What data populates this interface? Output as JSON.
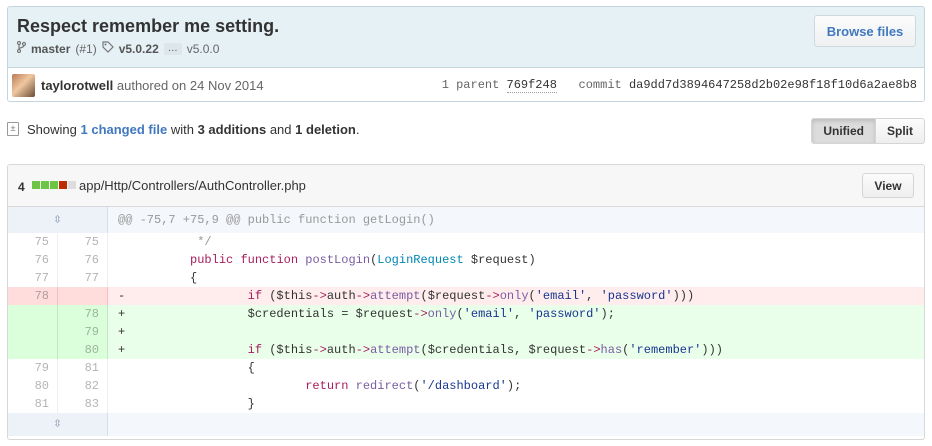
{
  "commit": {
    "title": "Respect remember me setting.",
    "branch": "master",
    "pr_ref": "(#1)",
    "tag_primary": "v5.0.22",
    "ellipsis": "…",
    "tag_secondary": "v5.0.0",
    "browse_label": "Browse files",
    "author": "taylorotwell",
    "authored_text": "authored on 24 Nov 2014",
    "parent_label": "1 parent",
    "parent_sha": "769f248",
    "commit_label": "commit",
    "commit_sha": "da9dd7d3894647258d2b02e98f18f10d6a2ae8b8"
  },
  "toc": {
    "showing": "Showing",
    "changed": "1 changed file",
    "with": "with",
    "additions": "3 additions",
    "and": "and",
    "deletions": "1 deletion",
    "period": ".",
    "unified": "Unified",
    "split": "Split"
  },
  "file": {
    "change_count": "4",
    "diffstat": [
      "#6cc644",
      "#6cc644",
      "#6cc644",
      "#bd2c00",
      "#ddd"
    ],
    "path": "app/Http/Controllers/AuthController.php",
    "view_label": "View"
  },
  "diff": {
    "hunk_header": "@@ -75,7 +75,9 @@ public function getLogin()",
    "lines": [
      {
        "old": "75",
        "new": "75",
        "marker": " ",
        "text": "         */"
      },
      {
        "old": "76",
        "new": "76",
        "marker": " ",
        "text": "        public function postLogin(LoginRequest $request)"
      },
      {
        "old": "77",
        "new": "77",
        "marker": " ",
        "text": "        {"
      },
      {
        "old": "78",
        "new": "",
        "marker": "-",
        "text": "                if ($this->auth->attempt($request->only('email', 'password')))"
      },
      {
        "old": "",
        "new": "78",
        "marker": "+",
        "text": "                $credentials = $request->only('email', 'password');"
      },
      {
        "old": "",
        "new": "79",
        "marker": "+",
        "text": ""
      },
      {
        "old": "",
        "new": "80",
        "marker": "+",
        "text": "                if ($this->auth->attempt($credentials, $request->has('remember')))"
      },
      {
        "old": "79",
        "new": "81",
        "marker": " ",
        "text": "                {"
      },
      {
        "old": "80",
        "new": "82",
        "marker": " ",
        "text": "                        return redirect('/dashboard');"
      },
      {
        "old": "81",
        "new": "83",
        "marker": " ",
        "text": "                }"
      }
    ]
  },
  "icons": {
    "branch": "branch-icon",
    "tag": "tag-icon",
    "expand": "unfold-icon",
    "file_toc": "file-diff-icon"
  }
}
